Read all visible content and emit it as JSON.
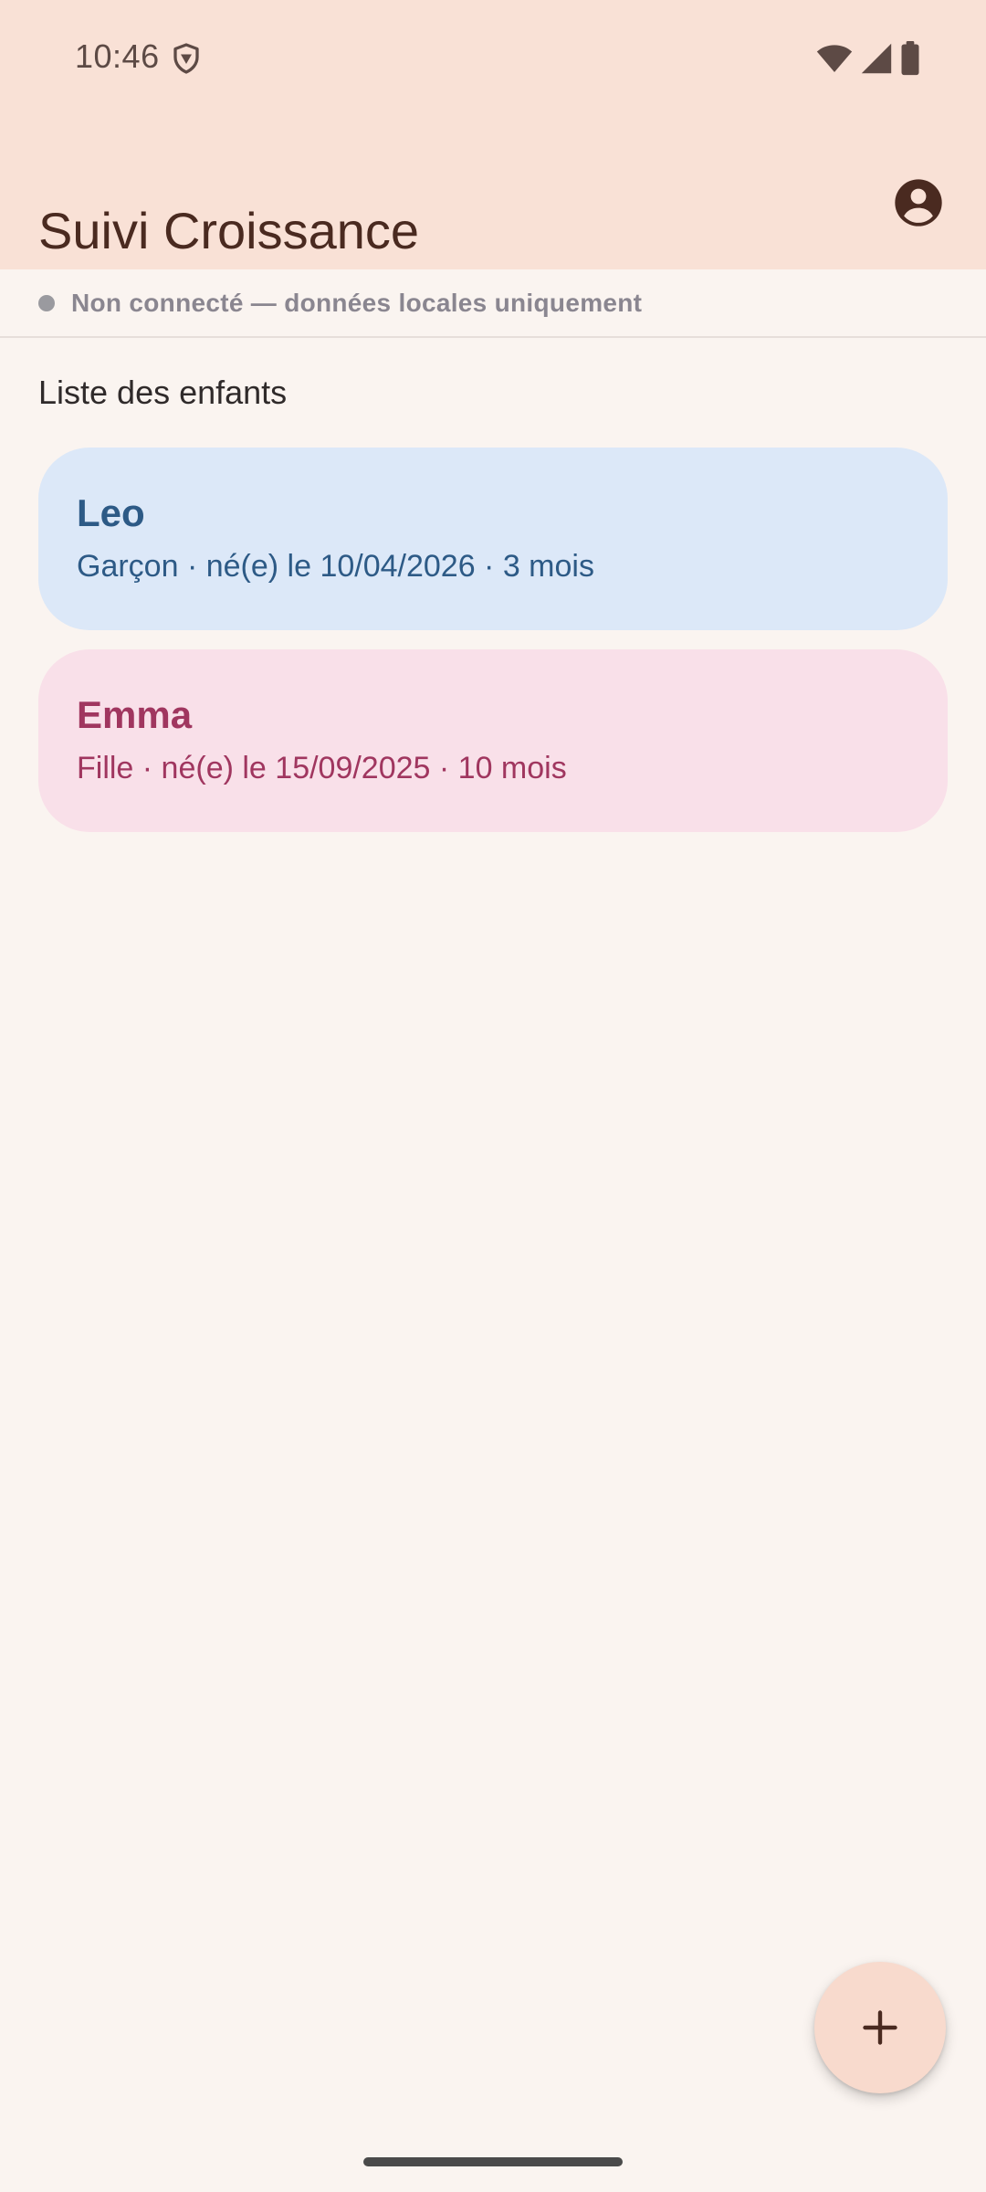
{
  "status_bar": {
    "time": "10:46",
    "icons": [
      "vpn-shield-icon",
      "wifi-icon",
      "cellular-signal-icon",
      "battery-icon"
    ]
  },
  "app_bar": {
    "title": "Suivi Croissance",
    "account_icon": "account-circle-icon"
  },
  "connection": {
    "status_text": "Non connecté — données locales uniquement",
    "dot_color": "#9A9A9F"
  },
  "children_section": {
    "title": "Liste des enfants",
    "items": [
      {
        "name": "Leo",
        "details": "Garçon · né(e) le 10/04/2026 · 3 mois",
        "color": "#2D5A86",
        "background": "#DCE8F8"
      },
      {
        "name": "Emma",
        "details": "Fille · né(e) le 15/09/2025 · 10 mois",
        "color": "#A0365F",
        "background": "#F9E0E9"
      }
    ]
  },
  "fab": {
    "icon": "plus-icon",
    "background": "#F8DACD"
  },
  "colors": {
    "header_background": "#F9E1D6",
    "page_background": "#FAF4F0",
    "title_color": "#4A2A20"
  }
}
